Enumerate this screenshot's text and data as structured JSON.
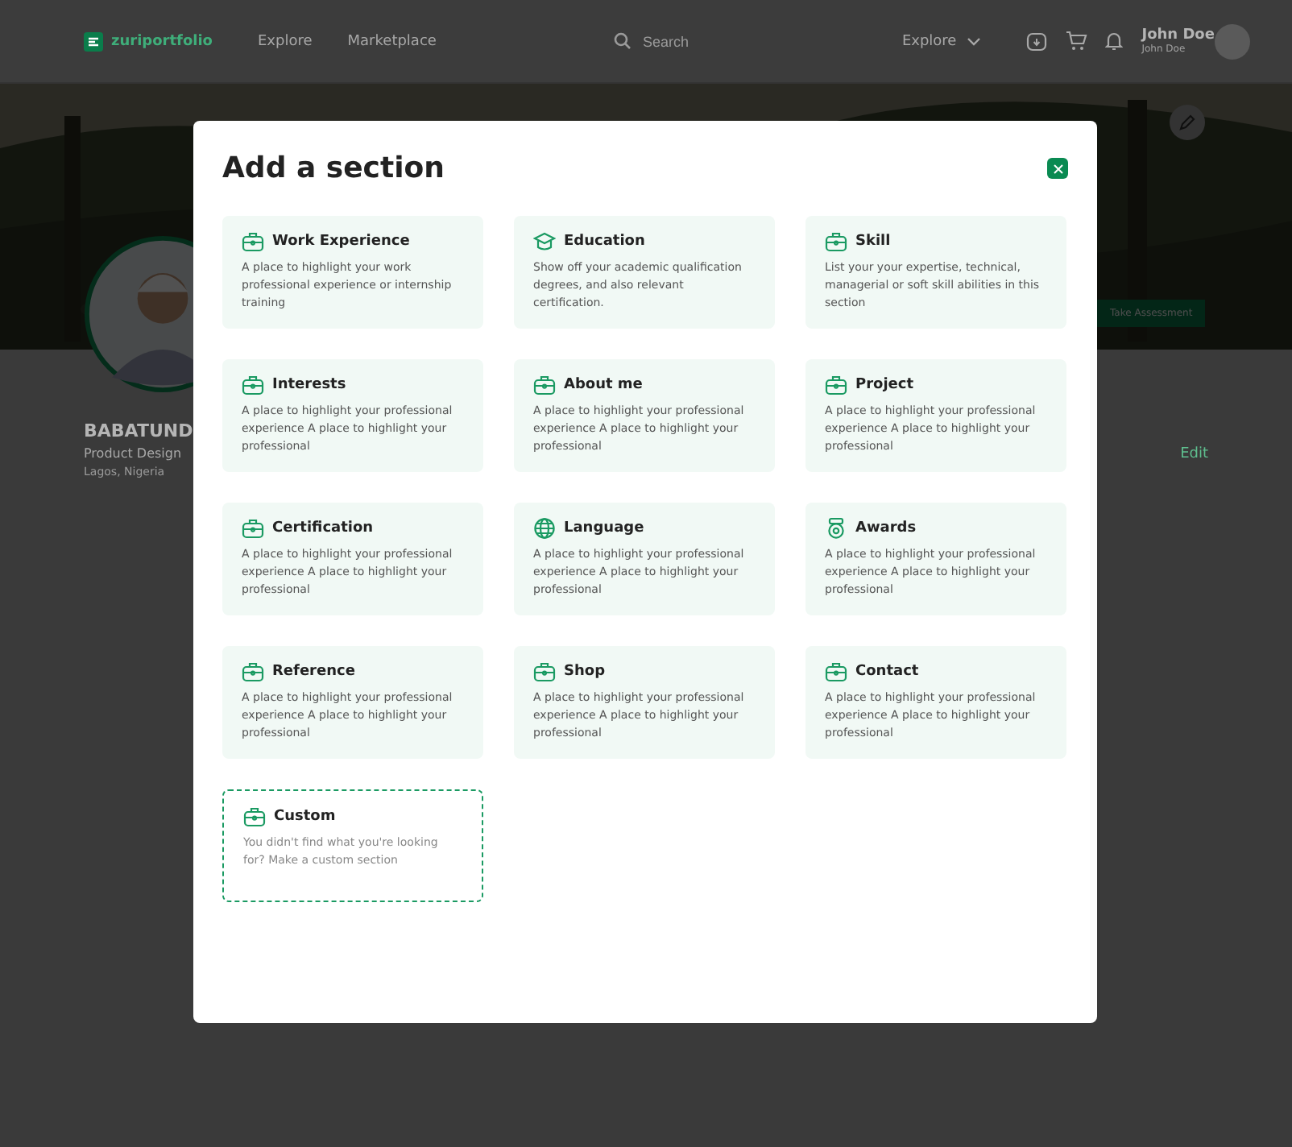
{
  "navbar": {
    "logo": "zuriportfolio",
    "links": [
      "Explore",
      "Marketplace"
    ],
    "search": {
      "placeholder": "Search"
    },
    "dropdown": "Explore",
    "user": {
      "name": "John Doe",
      "subtitle": "John Doe"
    }
  },
  "profile": {
    "name": "BABATUND",
    "role": "Product Design",
    "location": "Lagos, Nigeria",
    "assessment_button": "Take Assessment",
    "edit_link": "Edit"
  },
  "modal": {
    "title": "Add a section",
    "sections": [
      {
        "kind": "briefcase",
        "title": "Work Experience",
        "description": "A place to highlight your work professional experience or internship training"
      },
      {
        "kind": "cap",
        "title": "Education",
        "description": "Show off your  academic qualification degrees, and also relevant certification."
      },
      {
        "kind": "briefcase",
        "title": "Skill",
        "description": "List your your expertise, technical, managerial or soft skill abilities in this section"
      },
      {
        "kind": "briefcase",
        "title": "Interests",
        "description": "A place to highlight your professional experience A place to highlight your professional"
      },
      {
        "kind": "briefcase",
        "title": "About me",
        "description": "A place to highlight your professional experience A place to highlight your professional"
      },
      {
        "kind": "briefcase",
        "title": "Project",
        "description": "A place to highlight your professional experience A place to highlight your professional"
      },
      {
        "kind": "briefcase",
        "title": "Certification",
        "description": "A place to highlight your professional experience A place to highlight your professional"
      },
      {
        "kind": "globe",
        "title": "Language",
        "description": "A place to highlight your professional experience A place to highlight your professional"
      },
      {
        "kind": "medal",
        "title": "Awards",
        "description": "A place to highlight your professional experience A place to highlight your professional"
      },
      {
        "kind": "briefcase",
        "title": "Reference",
        "description": "A place to highlight your professional experience A place to highlight your professional"
      },
      {
        "kind": "briefcase",
        "title": "Shop",
        "description": "A place to highlight your professional experience A place to highlight your professional"
      },
      {
        "kind": "briefcase",
        "title": "Contact",
        "description": "A place to highlight your professional experience A place to highlight your professional"
      },
      {
        "kind": "custom",
        "title": "Custom",
        "description": "You didn't find what you're looking for? Make a custom section"
      }
    ]
  }
}
